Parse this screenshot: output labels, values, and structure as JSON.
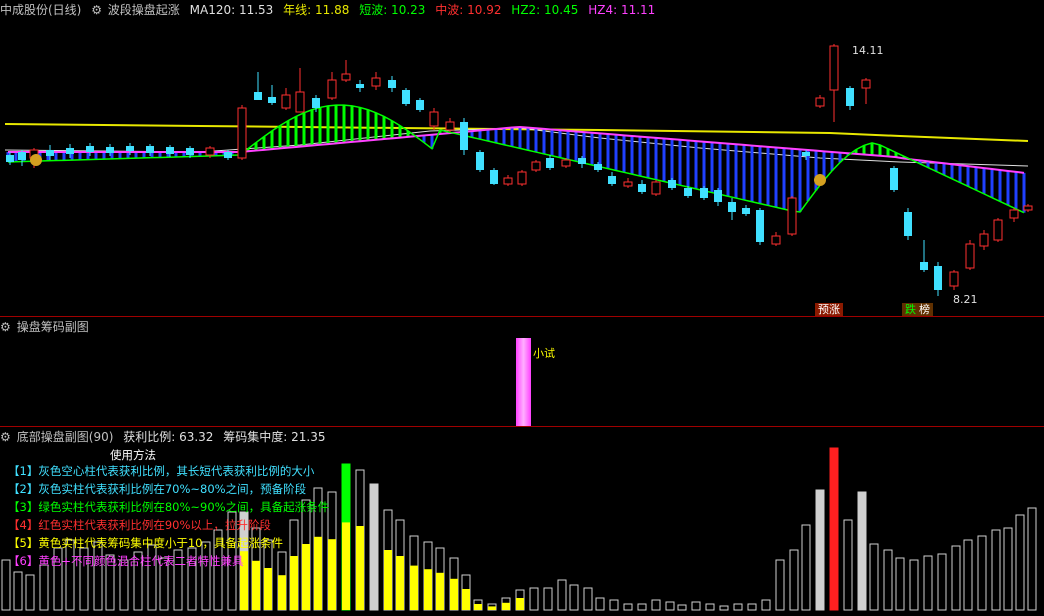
{
  "main_header": {
    "icon": "settings-gear-icon",
    "stock": "中成股份(日线)",
    "indicator": "波段操盘起涨",
    "items": [
      {
        "label": "MA120: 11.53",
        "color": "#e0e0e0"
      },
      {
        "label": "年线: 11.88",
        "color": "#e8e800"
      },
      {
        "label": "短波: 10.23",
        "color": "#00ff00"
      },
      {
        "label": "中波: 10.92",
        "color": "#ff3030"
      },
      {
        "label": "HZ2: 10.45",
        "color": "#00ff00"
      },
      {
        "label": "HZ4: 11.11",
        "color": "#ff40ff"
      }
    ]
  },
  "price_panel": {
    "high_label": "14.11",
    "low_label": "8.21",
    "tag_yuzhang": "预涨",
    "tag_die": "跌",
    "tag_bang": "榜"
  },
  "mid_panel": {
    "title": "操盘筹码副图",
    "bar_label": "小试"
  },
  "bottom_panel": {
    "title": "底部操盘副图(90)",
    "ratio": "获利比例: 63.32",
    "concentration": "筹码集中度: 21.35",
    "legend_title": "使用方法",
    "legend": [
      {
        "text": "【1】灰色空心柱代表获利比例，其长短代表获利比例的大小",
        "color": "#40e0ff"
      },
      {
        "text": "【2】灰色实柱代表获利比例在70%~80%之间，预备阶段",
        "color": "#40e0ff"
      },
      {
        "text": "【3】绿色实柱代表获利比例在80%~90%之间，具备起涨条件",
        "color": "#00ff00"
      },
      {
        "text": "【4】红色实柱代表获利比例在90%以上，拉升阶段",
        "color": "#ff3030"
      },
      {
        "text": "【5】黄色实柱代表筹码集中度小于10，具备起涨条件",
        "color": "#ffff00"
      },
      {
        "text": "【6】黄色+不同颜色混合柱代表二者特性兼具",
        "color": "#ff40ff"
      }
    ]
  },
  "colors": {
    "up": "#ff3030",
    "down": "#40e0ff",
    "ma120": "#e0e0e0",
    "year": "#e8e800",
    "short": "#00ff00",
    "mid": "#ff3030",
    "hz2": "#00ff00",
    "hz4": "#ff40ff",
    "separator": "#a00000"
  }
}
